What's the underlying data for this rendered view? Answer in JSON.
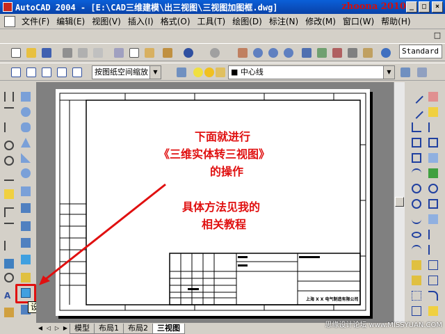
{
  "window": {
    "title": "AutoCAD 2004 - [E:\\CAD三维建模\\出三视图\\三视图加图框.dwg]",
    "watermark": "zhoona 2010",
    "min_label": "_",
    "max_label": "□",
    "close_label": "×"
  },
  "menu": {
    "items": [
      "文件(F)",
      "编辑(E)",
      "视图(V)",
      "插入(I)",
      "格式(O)",
      "工具(T)",
      "绘图(D)",
      "标注(N)",
      "修改(M)",
      "窗口(W)",
      "帮助(H)"
    ],
    "restore_label": "□"
  },
  "toolbar1": {
    "text_style": "Standard"
  },
  "toolbar2": {
    "view_combo": "按图纸空间缩放",
    "layer_combo": "■ 中心线"
  },
  "annotation": {
    "line1": "下面就进行",
    "line2": "《三维实体转三视图》",
    "line3": "的操作",
    "line4": "具体方法见我的",
    "line5": "相关教程"
  },
  "tooltip": "设置视图",
  "tabs": [
    "模型",
    "布局1",
    "布局2",
    "三视图"
  ],
  "title_block": {
    "company": "上海 X X 电气制造有限公司"
  },
  "site_mark": "思缘设计论坛 www.MISSYUAN.COM",
  "colors": {
    "annotation_red": "#e01010",
    "title_blue": "#0a5fd8"
  }
}
